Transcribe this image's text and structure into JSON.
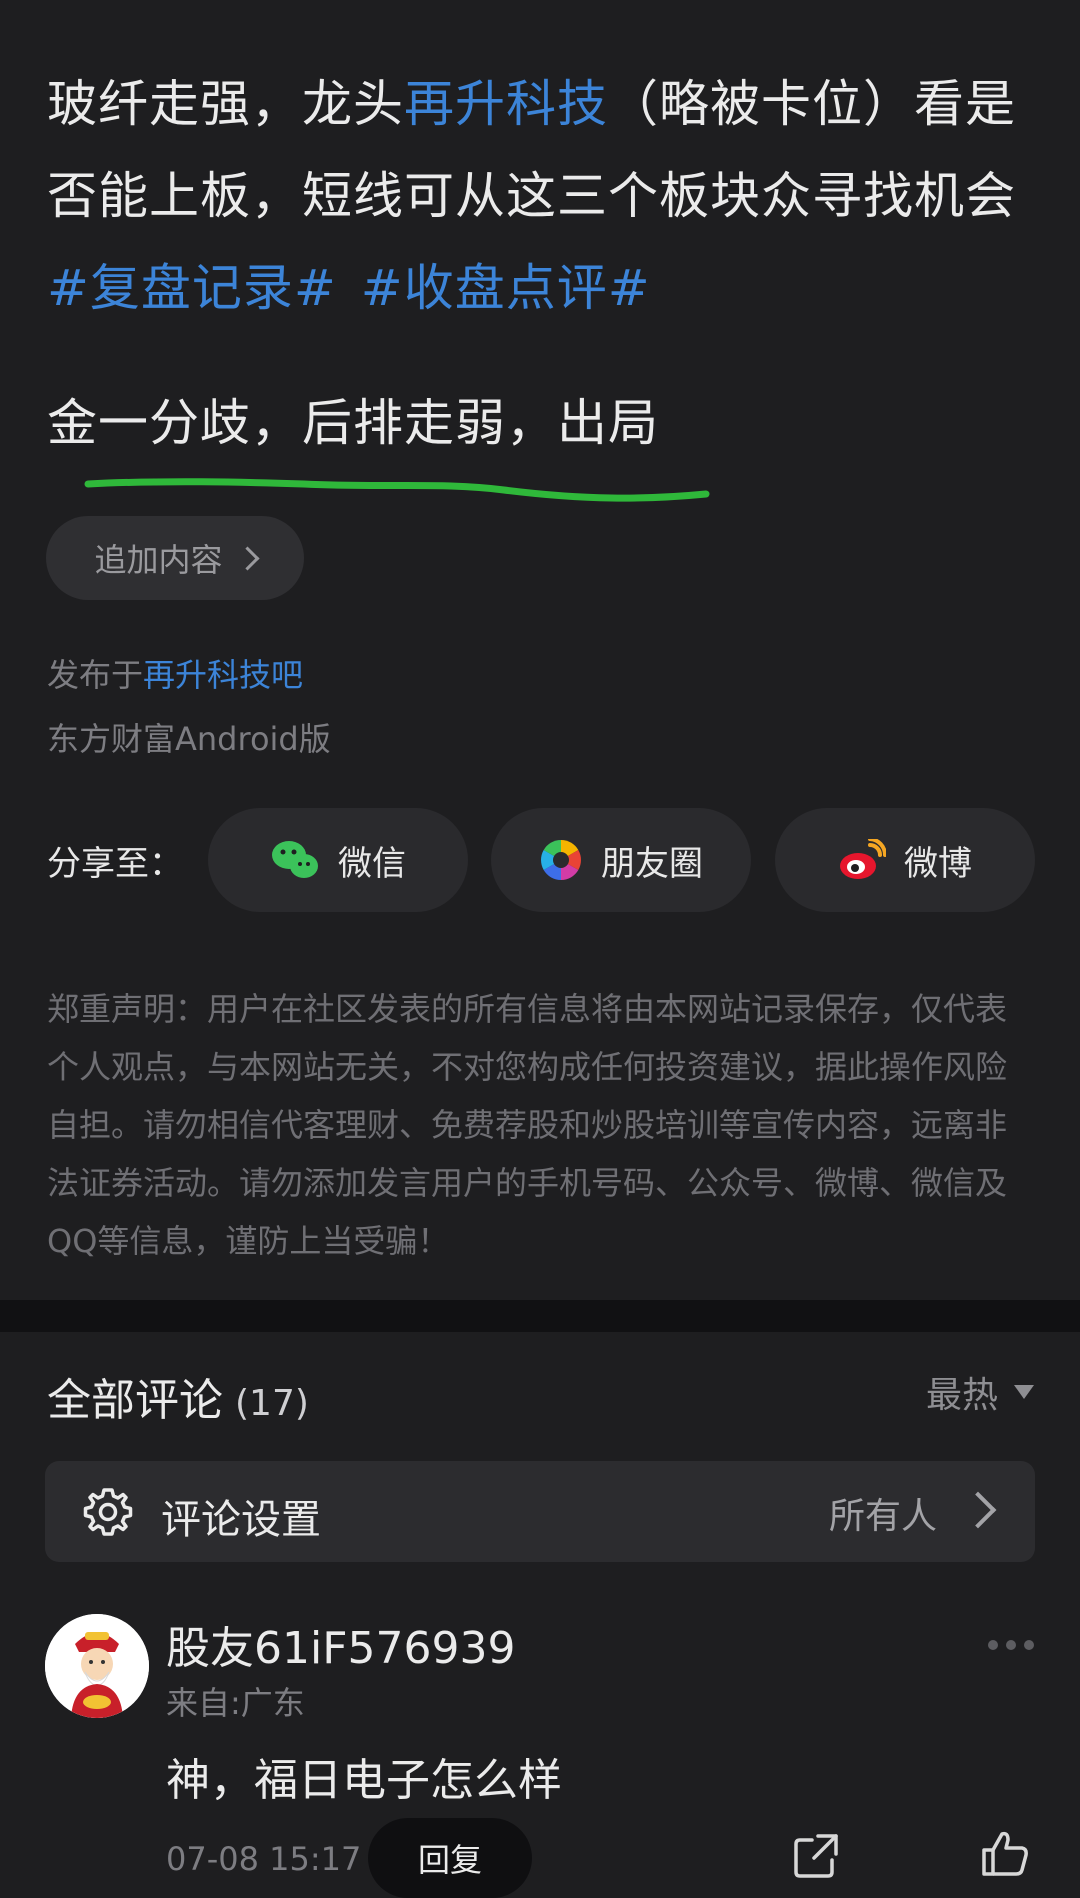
{
  "post": {
    "title_part1": "玻纤走强，龙头",
    "title_link": "再升科技",
    "title_part2": "（略被卡位）看是否能上板，短线可从这三个板块众寻找机会",
    "hashtags": [
      "#复盘记录#",
      "#收盘点评#"
    ],
    "update_text": "金一分歧，后排走弱，出局",
    "append_label": "追加内容",
    "published_prefix": "发布于",
    "published_bar": "再升科技吧",
    "client": "东方财富Android版"
  },
  "share": {
    "label": "分享至：",
    "buttons": [
      {
        "label": "微信",
        "icon": "wechat-icon"
      },
      {
        "label": "朋友圈",
        "icon": "moments-icon"
      },
      {
        "label": "微博",
        "icon": "weibo-icon"
      }
    ]
  },
  "disclaimer": "郑重声明：用户在社区发表的所有信息将由本网站记录保存，仅代表个人观点，与本网站无关，不对您构成任何投资建议，据此操作风险自担。请勿相信代客理财、免费荐股和炒股培训等宣传内容，远离非法证券活动。请勿添加发言用户的手机号码、公众号、微博、微信及QQ等信息，谨防上当受骗！",
  "comments": {
    "title": "全部评论",
    "count": "(17)",
    "sort": "最热",
    "settings_label": "评论设置",
    "settings_value": "所有人",
    "items": [
      {
        "username": "股友61iF576939",
        "location": "来自:广东",
        "text": "神，福日电子怎么样",
        "time": "07-08 15:17",
        "reply_label": "回复"
      }
    ]
  },
  "colors": {
    "background": "#1e1e20",
    "link": "#3c84d8",
    "underline": "#2fb83a"
  }
}
